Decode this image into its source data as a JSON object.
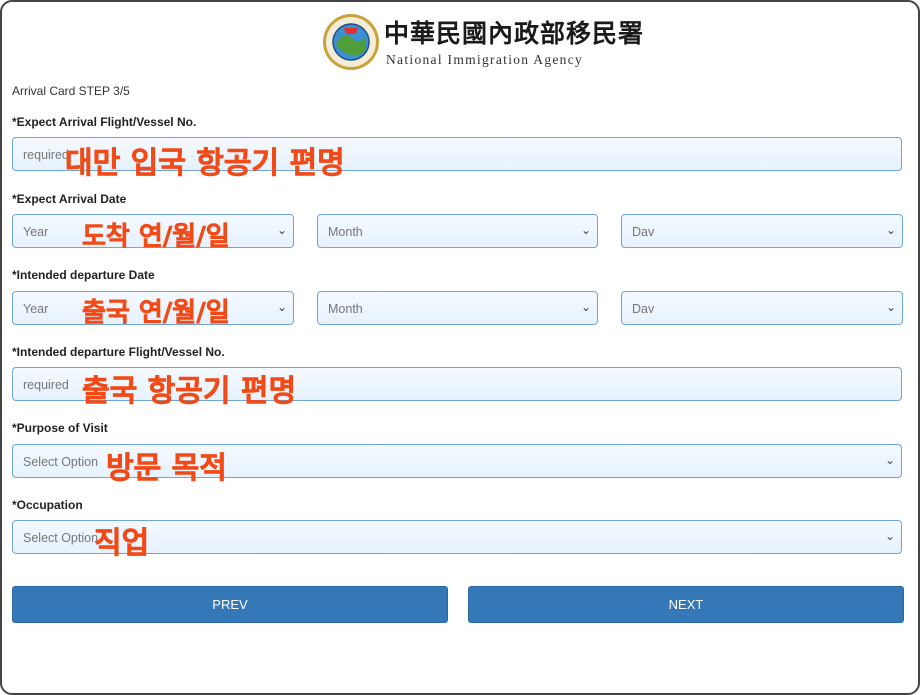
{
  "header": {
    "agency_zh": "中華民國內政部移民署",
    "agency_en": "National Immigration Agency",
    "seal_icon": "immigration-agency-seal"
  },
  "step": "Arrival Card STEP 3/5",
  "fields": {
    "arrival_flight": {
      "label": "*Expect Arrival Flight/Vessel No.",
      "placeholder": "required",
      "annotation": "대만 입국 항공기 편명"
    },
    "arrival_date": {
      "label": "*Expect Arrival Date",
      "year": "Year",
      "month": "Month",
      "day": "Dav",
      "annotation": "도착 연/월/일"
    },
    "departure_date": {
      "label": "*Intended departure Date",
      "year": "Year",
      "month": "Month",
      "day": "Dav",
      "annotation": "출국 연/월/일"
    },
    "departure_flight": {
      "label": "*Intended departure Flight/Vessel No.",
      "placeholder": "required",
      "annotation": "출국 항공기 편명"
    },
    "purpose": {
      "label": "*Purpose of Visit",
      "value": "Select Option",
      "annotation": "방문 목적"
    },
    "occupation": {
      "label": "*Occupation",
      "value": "Select Option",
      "annotation": "직업"
    }
  },
  "buttons": {
    "prev": "PREV",
    "next": "NEXT"
  },
  "colors": {
    "button": "#3578b8",
    "field_border": "#6fa6d6",
    "annotation": "#f24a16"
  }
}
